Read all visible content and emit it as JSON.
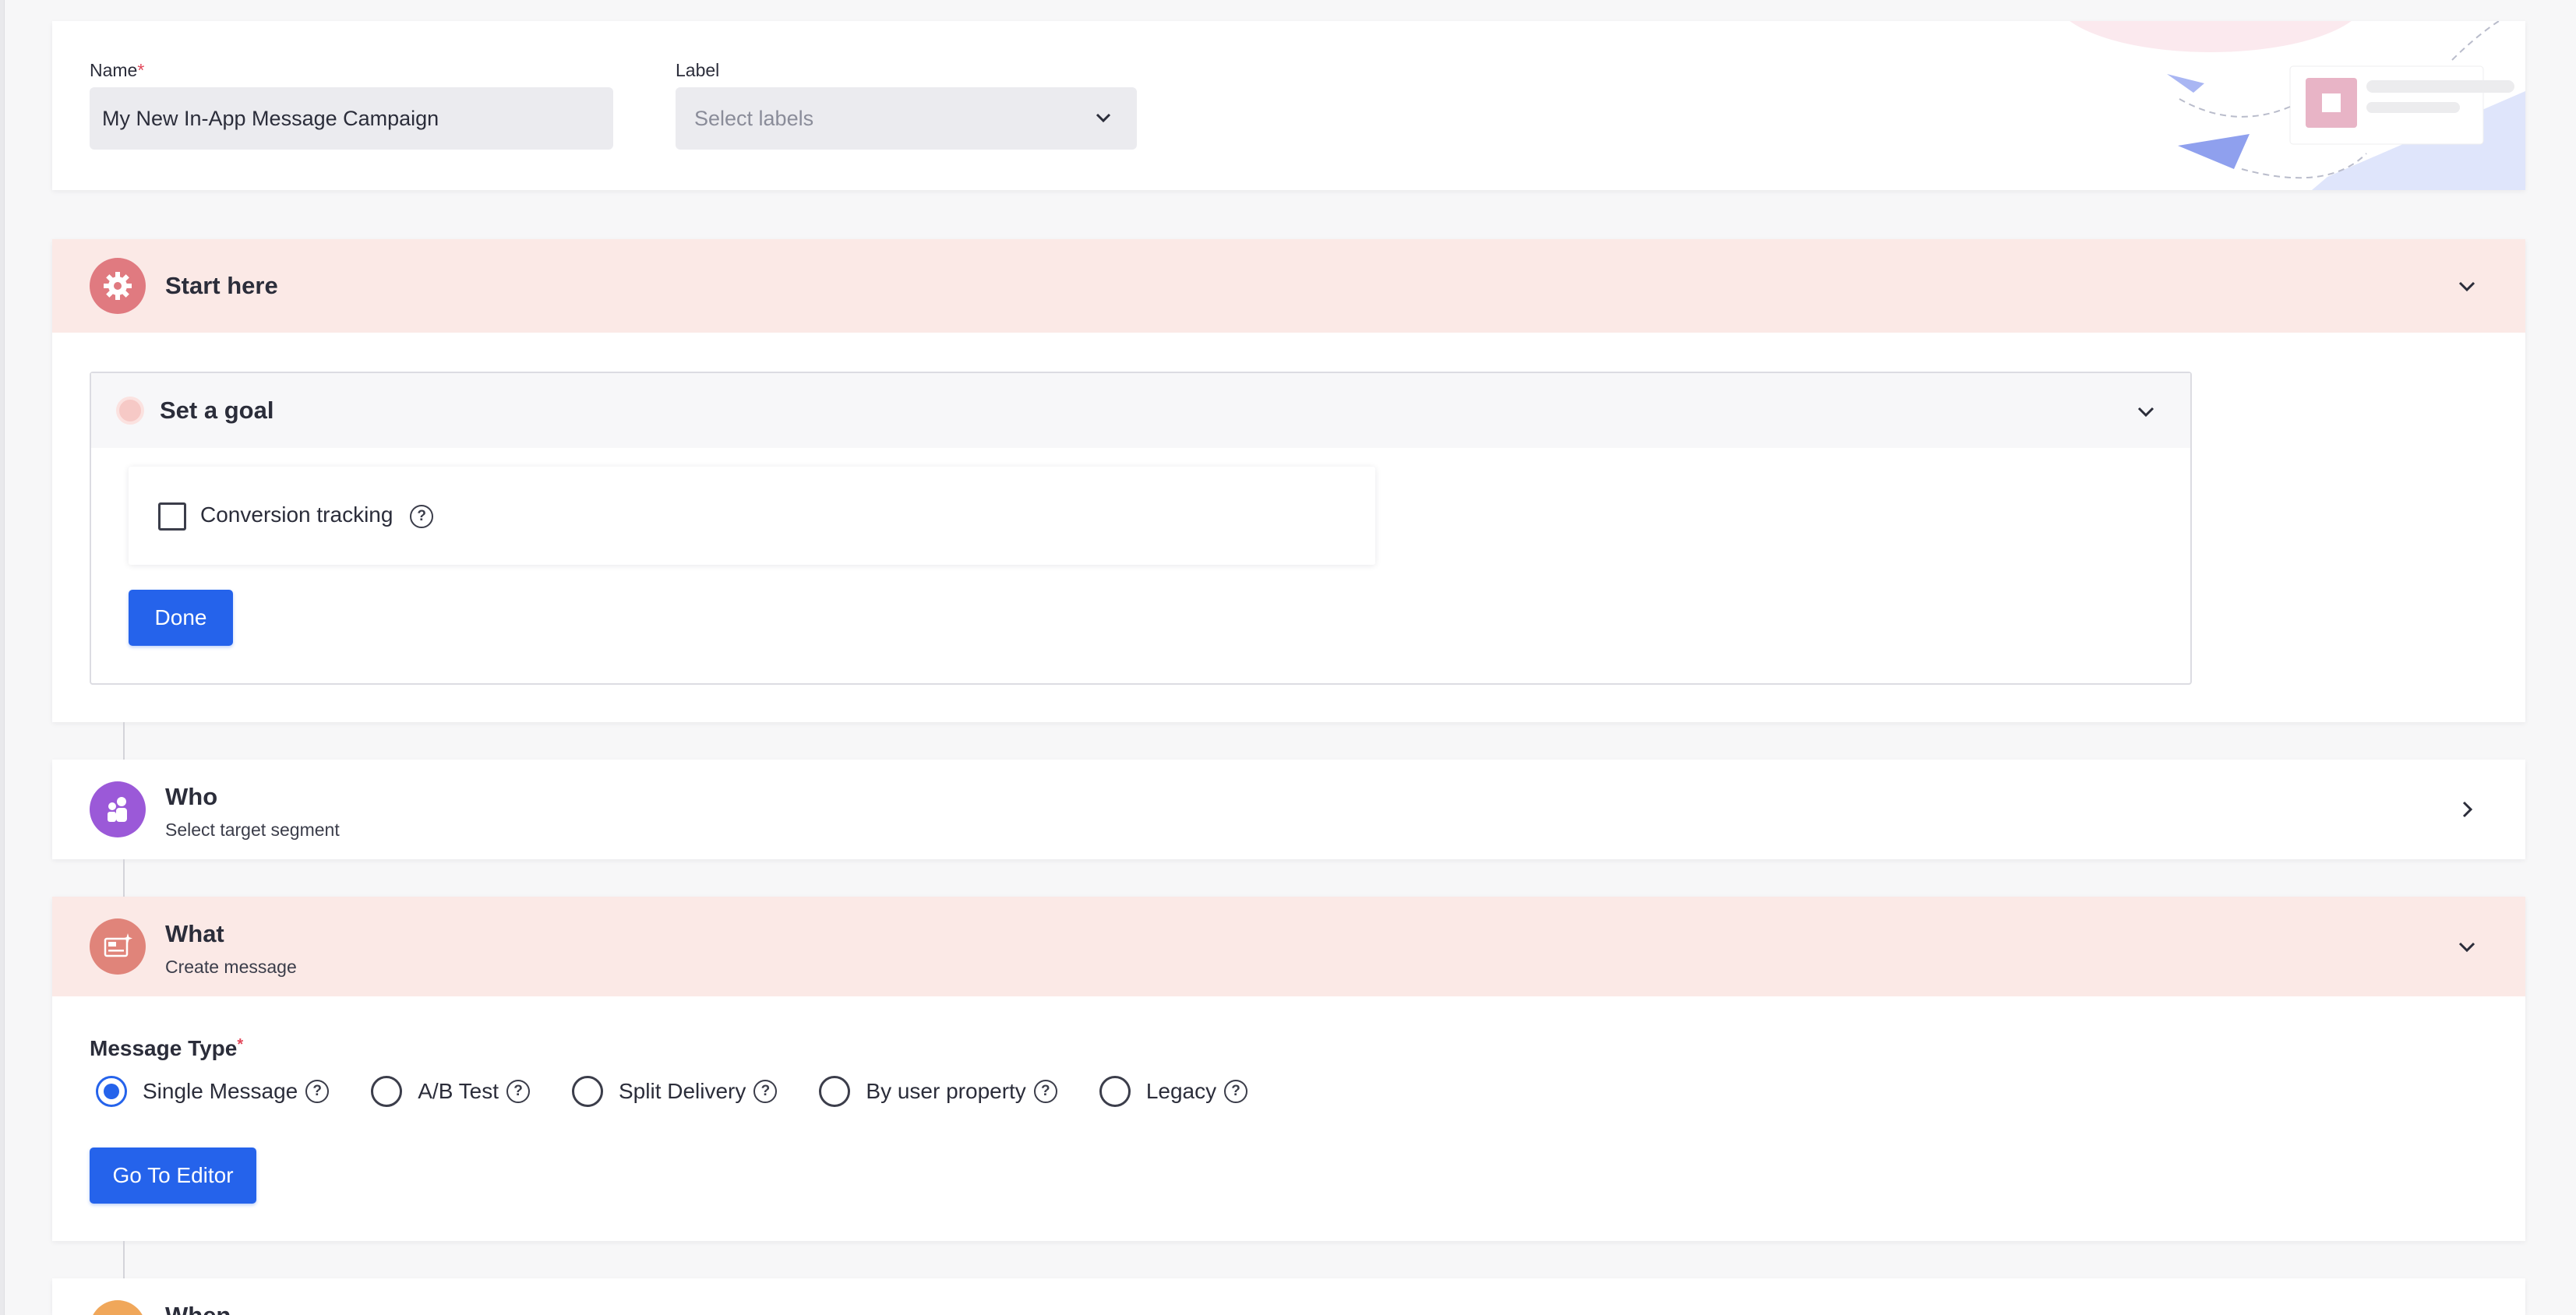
{
  "campaign": {
    "name_label": "Name",
    "required_mark": "*",
    "name_value": "My New In-App Message Campaign",
    "label_label": "Label",
    "label_placeholder": "Select labels"
  },
  "start_here": {
    "title": "Start here",
    "goal": {
      "title": "Set a goal",
      "conversion_label": "Conversion tracking",
      "help_glyph": "?",
      "done_label": "Done"
    }
  },
  "who": {
    "title": "Who",
    "subtitle": "Select target segment"
  },
  "what": {
    "title": "What",
    "subtitle": "Create message",
    "message_type_label": "Message Type",
    "options": [
      {
        "label": "Single Message",
        "selected": true
      },
      {
        "label": "A/B Test",
        "selected": false
      },
      {
        "label": "Split Delivery",
        "selected": false
      },
      {
        "label": "By user property",
        "selected": false
      },
      {
        "label": "Legacy",
        "selected": false
      }
    ],
    "go_to_editor_label": "Go To Editor"
  },
  "when": {
    "title": "When"
  },
  "colors": {
    "accent": "#2563eb",
    "section_header_bg": "#fbe9e6",
    "start_icon": "#e07a80",
    "who_icon": "#9b59d8",
    "what_icon": "#e0847a",
    "when_icon": "#f0a75a"
  },
  "icons": {
    "start": "gear-icon",
    "who": "users-icon",
    "what": "message-editor-icon",
    "chevron_down": "chevron-down-icon",
    "chevron_right": "chevron-right-icon"
  }
}
